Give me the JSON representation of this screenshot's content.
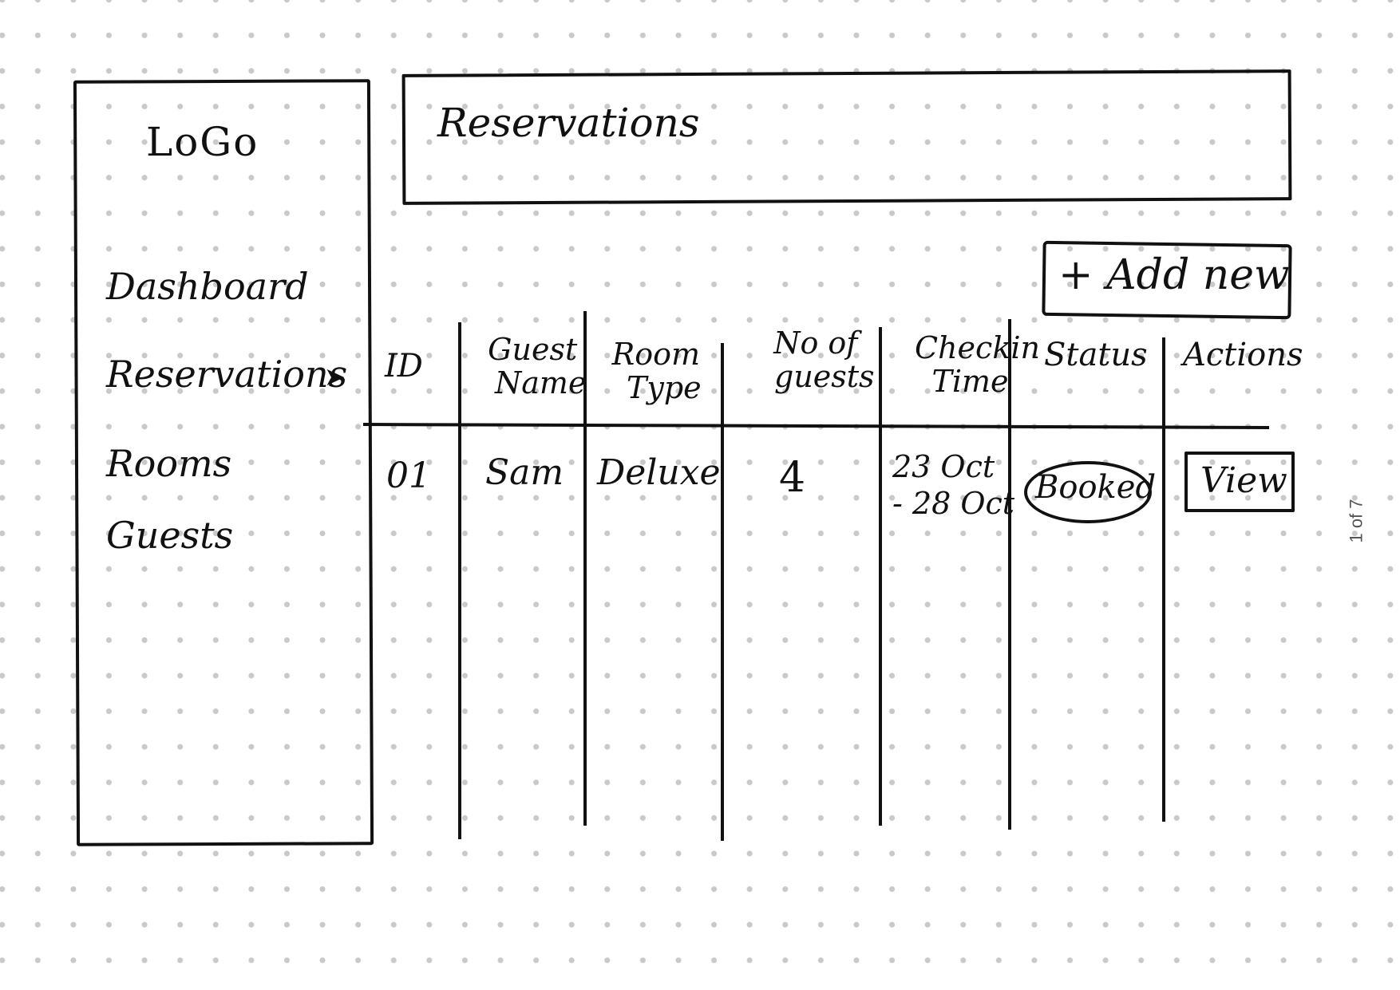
{
  "sidebar": {
    "logo": "LoGo",
    "items": [
      {
        "label": "Dashboard"
      },
      {
        "label": "Reservations"
      },
      {
        "label": "Rooms"
      },
      {
        "label": "Guests"
      }
    ],
    "active_marker": "➤"
  },
  "header": {
    "title": "Reservations"
  },
  "toolbar": {
    "add_new_label": "+ Add new"
  },
  "table": {
    "columns": [
      {
        "label": "ID"
      },
      {
        "label_line1": "Guest",
        "label_line2": "Name"
      },
      {
        "label_line1": "Room",
        "label_line2": "Type"
      },
      {
        "label_line1": "No of",
        "label_line2": "guests"
      },
      {
        "label_line1": "Checkin",
        "label_line2": "Time"
      },
      {
        "label": "Status"
      },
      {
        "label": "Actions"
      }
    ],
    "rows": [
      {
        "id": "01",
        "guest_name": "Sam",
        "room_type": "Deluxe",
        "guests": "4",
        "checkin_line1": "23 Oct",
        "checkin_line2": "- 28 Oct",
        "status": "Booked",
        "action": "View"
      }
    ]
  },
  "footer": {
    "page_counter": "1 of 7"
  }
}
